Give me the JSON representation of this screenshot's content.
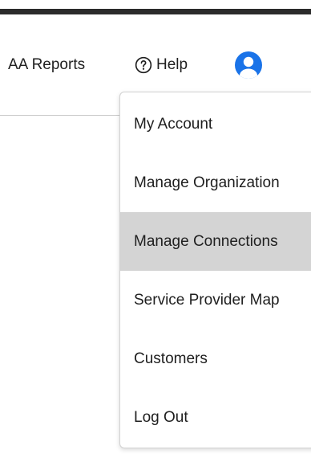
{
  "header": {
    "reports_label": "AA Reports",
    "help_label": "Help"
  },
  "icons": {
    "help": "question-circle-icon",
    "avatar": "user-avatar-icon"
  },
  "colors": {
    "accent": "#1a73e8",
    "highlight": "#d4d4d4",
    "top_bar": "#2b2b2b"
  },
  "menu": {
    "items": [
      {
        "label": "My Account"
      },
      {
        "label": "Manage Organization"
      },
      {
        "label": "Manage Connections"
      },
      {
        "label": "Service Provider Map"
      },
      {
        "label": "Customers"
      },
      {
        "label": "Log Out"
      }
    ],
    "highlighted": "Manage Connections"
  }
}
